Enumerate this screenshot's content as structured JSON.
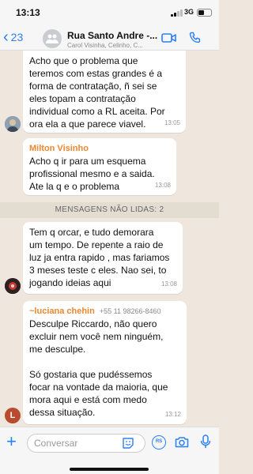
{
  "status_bar": {
    "time": "13:13",
    "network": "3G"
  },
  "header": {
    "back_count": "23",
    "title": "Rua Santo Andre -...",
    "subtitle": "Carol Visinha, Celinho, C..."
  },
  "messages": [
    {
      "text": "Acho que o problema que\nteremos com estas grandes é a\nforma de contratação, ñ sei se\neles topam a contratação\nindividual como a RL aceita. Por\nora ela a que parece viavel.",
      "time": "13:05"
    },
    {
      "sender": "Milton Visinho",
      "text": "Acho q ir para um esquema\nprofissional mesmo e a saida.\nAte la q e o problema",
      "time": "13:08"
    },
    {
      "text": "Tem q orcar, e tudo demorara\num tempo. De repente a raio de\nluz ja entra rapido , mas fariamos\n3 meses teste c eles. Nao sei, to\njogando ideias aqui",
      "time": "13:08"
    },
    {
      "sender": "~luciana chehin",
      "phone": "+55 11 98266-8460",
      "text": "Desculpe Riccardo, não quero\nexcluir nem você nem ninguém,\nme desculpe.\n\nSó gostaria que pudéssemos\nfocar na vontade da maioria, que\nmora aqui e está com medo\ndessa situação.",
      "time": "13:12"
    }
  ],
  "unread_separator": "MENSAGENS NÃO LIDAS: 2",
  "avatars": {
    "luciana_initial": "L"
  },
  "composer": {
    "placeholder": "Conversar",
    "rs_label": "RS"
  },
  "colors": {
    "accent": "#2b7ff6",
    "sender_name": "#f0862e",
    "chat_bg": "#efe7de"
  }
}
